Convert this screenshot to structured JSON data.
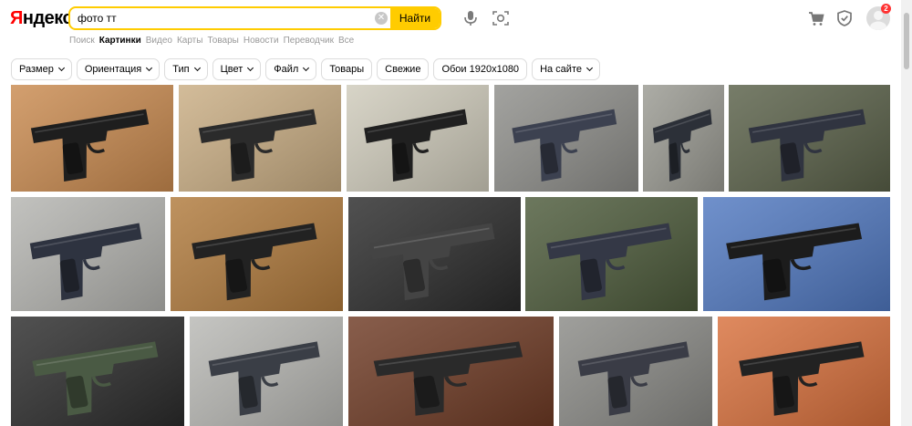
{
  "brand": "Яндекс",
  "search": {
    "query": "фото тт",
    "button": "Найти"
  },
  "tabs": [
    "Поиск",
    "Картинки",
    "Видео",
    "Карты",
    "Товары",
    "Новости",
    "Переводчик",
    "Все"
  ],
  "active_tab": "Картинки",
  "notifications_count": "2",
  "filters": [
    {
      "label": "Размер",
      "dropdown": true
    },
    {
      "label": "Ориентация",
      "dropdown": true
    },
    {
      "label": "Тип",
      "dropdown": true
    },
    {
      "label": "Цвет",
      "dropdown": true
    },
    {
      "label": "Файл",
      "dropdown": true
    },
    {
      "label": "Товары",
      "dropdown": false
    },
    {
      "label": "Свежие",
      "dropdown": false
    },
    {
      "label": "Обои 1920x1080",
      "dropdown": false
    },
    {
      "label": "На сайте",
      "dropdown": true
    }
  ],
  "icons": [
    "microphone-icon",
    "camera-search-icon",
    "cart-icon",
    "shield-icon",
    "clear-icon",
    "chevron-down-icon"
  ],
  "colors": {
    "accent": "#ffcc00",
    "logo_red": "#ff0000",
    "badge": "#ff3333"
  },
  "images": [
    {
      "bg": "#c98a4f",
      "gun": "#1e1e1e"
    },
    {
      "bg": "#c9ad83",
      "gun": "#2b2b2b"
    },
    {
      "bg": "#cfcbbb",
      "gun": "#202020"
    },
    {
      "bg": "#8e8e8a",
      "gun": "#3c4150"
    },
    {
      "bg": "#9a9a92",
      "gun": "#2c3038"
    },
    {
      "bg": "#596048",
      "gun": "#303440"
    },
    {
      "bg": "#b4b4b0",
      "gun": "#2e3340"
    },
    {
      "bg": "#b07a3c",
      "gun": "#222222"
    },
    {
      "bg": "#2a2a2a",
      "gun": "#444444"
    },
    {
      "bg": "#4c5a3a",
      "gun": "#343846"
    },
    {
      "bg": "#5078c0",
      "gun": "#1c1c1c"
    },
    {
      "bg": "#2b2b2b",
      "gun": "#4a5a44"
    },
    {
      "bg": "#b8b8b4",
      "gun": "#3a3e46"
    },
    {
      "bg": "#6e3a24",
      "gun": "#2a2a2a"
    },
    {
      "bg": "#8a8a86",
      "gun": "#3a3c46"
    },
    {
      "bg": "#d8703c",
      "gun": "#222222"
    }
  ]
}
